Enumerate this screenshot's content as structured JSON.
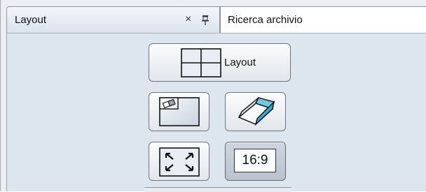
{
  "tabs": [
    {
      "label": "Layout",
      "active": true,
      "close": "×"
    },
    {
      "label": "Ricerca archivio",
      "active": false
    }
  ],
  "buttons": {
    "layout_label": "Layout",
    "aspect_label": "16:9"
  },
  "icons": [
    "layout-grid-icon",
    "clear-region-icon",
    "eraser-icon",
    "fullscreen-icon",
    "pin-icon"
  ],
  "colors": {
    "panel": "#dde5ef",
    "tab_active": "#e4eaf2",
    "border": "#6e7580"
  }
}
